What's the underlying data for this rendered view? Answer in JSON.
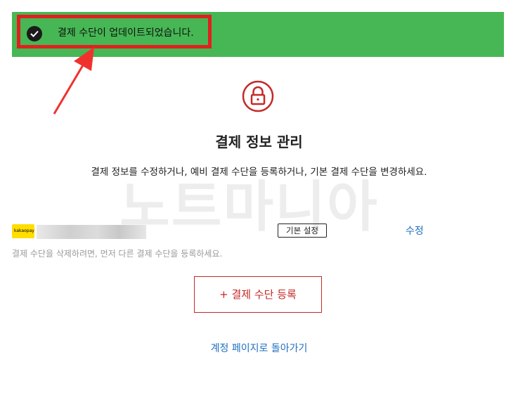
{
  "banner": {
    "message": "결제 수단이 업데이트되었습니다.",
    "icon": "check-circle-icon",
    "background_color": "#46b754",
    "highlight_color": "#e02020"
  },
  "header": {
    "icon": "lock-icon",
    "title": "결제 정보 관리",
    "description": "결제 정보를 수정하거나, 예비 결제 수단을 등록하거나, 기본 결제 수단을 변경하세요."
  },
  "watermark": "노트마니아",
  "payment_method": {
    "provider_logo_text": "kakaopay",
    "badge": "기본 설정",
    "edit_label": "수정"
  },
  "delete_note": "결제 수단을 삭제하려면, 먼저 다른 결제 수단을 등록하세요.",
  "add_button_label": "+ 결제 수단 등록",
  "back_link": "계정 페이지로 돌아가기",
  "colors": {
    "accent": "#c62828",
    "link": "#1f6fbf"
  }
}
